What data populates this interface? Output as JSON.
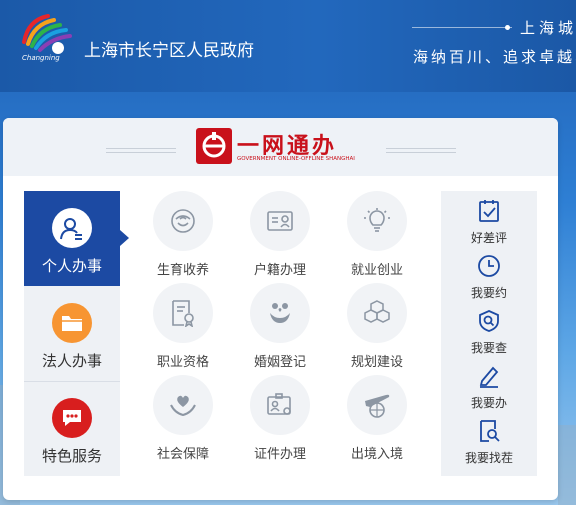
{
  "header": {
    "site_title": "上海市长宁区人民政府",
    "slogan_line1": "上海城",
    "slogan_line2": "海纳百川、追求卓越、",
    "logo_text": "Changning"
  },
  "banner": {
    "title": "一网通办",
    "subtitle": "GOVERNMENT ONLINE-OFFLINE SHANGHAI"
  },
  "left_nav": [
    {
      "label": "个人办事",
      "icon": "person-icon",
      "active": true
    },
    {
      "label": "法人办事",
      "icon": "folder-icon",
      "active": false
    },
    {
      "label": "特色服务",
      "icon": "chat-icon",
      "active": false
    }
  ],
  "services": [
    {
      "label": "生育收养",
      "icon": "baby-icon"
    },
    {
      "label": "户籍办理",
      "icon": "id-card-icon"
    },
    {
      "label": "就业创业",
      "icon": "lightbulb-icon"
    },
    {
      "label": "职业资格",
      "icon": "certificate-icon"
    },
    {
      "label": "婚姻登记",
      "icon": "marriage-icon"
    },
    {
      "label": "规划建设",
      "icon": "blocks-icon"
    },
    {
      "label": "社会保障",
      "icon": "heart-hands-icon"
    },
    {
      "label": "证件办理",
      "icon": "badge-icon"
    },
    {
      "label": "出境入境",
      "icon": "plane-globe-icon"
    }
  ],
  "quick_links": [
    {
      "label": "好差评",
      "icon": "clipboard-check-icon"
    },
    {
      "label": "我要约",
      "icon": "clock-icon"
    },
    {
      "label": "我要查",
      "icon": "shield-search-icon"
    },
    {
      "label": "我要办",
      "icon": "pen-icon"
    },
    {
      "label": "我要找茬",
      "icon": "doc-search-icon"
    }
  ],
  "colors": {
    "header_blue": "#1f5fb4",
    "nav_active": "#1c4aa3",
    "brand_red": "#c9111b",
    "icon_blue": "#1c4aa3",
    "folder_orange": "#f79532"
  }
}
